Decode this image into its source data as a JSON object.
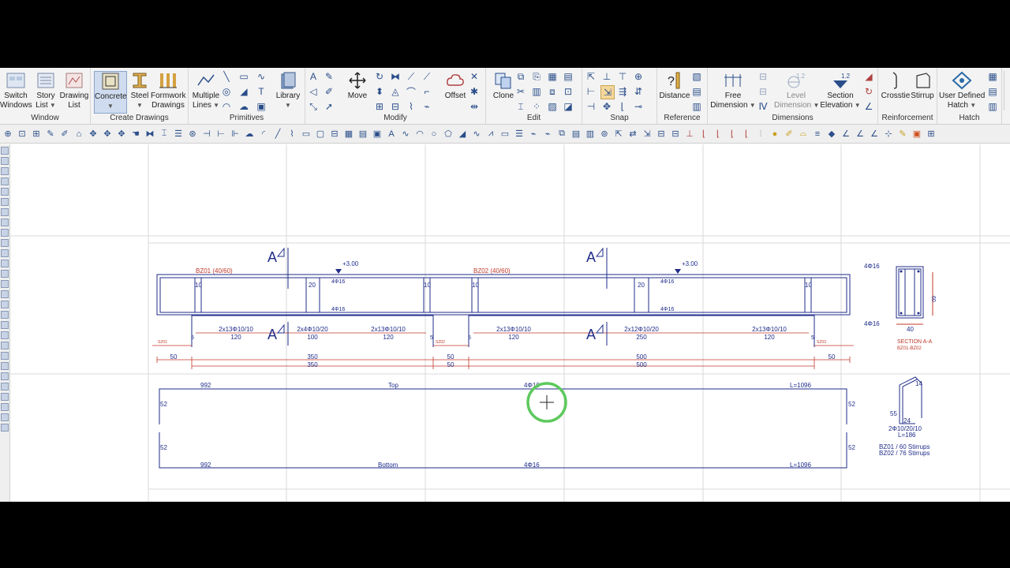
{
  "ribbon": {
    "window": {
      "title": "Window",
      "switch": "Switch",
      "switch2": "Windows",
      "story": "Story",
      "story2": "List",
      "drawing": "Drawing",
      "drawing2": "List"
    },
    "create": {
      "title": "Create Drawings",
      "concrete": "Concrete",
      "steel": "Steel",
      "formwork": "Formwork",
      "formwork2": "Drawings"
    },
    "primitives": {
      "title": "Primitives",
      "multiple": "Multiple",
      "multiple2": "Lines",
      "library": "Library"
    },
    "modify": {
      "title": "Modify",
      "move": "Move",
      "offset": "Offset"
    },
    "edit": {
      "title": "Edit",
      "clone": "Clone"
    },
    "snap": {
      "title": "Snap"
    },
    "reference": {
      "title": "Reference",
      "distance": "Distance"
    },
    "dimensions": {
      "title": "Dimensions",
      "free": "Free",
      "free2": "Dimension",
      "level": "Level",
      "level2": "Dimension",
      "level_val": "1.2",
      "section": "Section",
      "section2": "Elevation",
      "section_val": "1.2"
    },
    "reinforcement": {
      "title": "Reinforcement",
      "crosstie": "Crosstie",
      "stirrup": "Stirrup"
    },
    "hatch": {
      "title": "Hatch",
      "user": "User Defined",
      "user2": "Hatch"
    }
  },
  "drawing": {
    "beam1_label": "BZ01 (40/60)",
    "beam2_label": "BZ02 (40/60)",
    "level1": "+3.00",
    "level2": "+3.00",
    "section_mark": "A",
    "top_bar": "4Φ16",
    "bottom_bar": "4Φ16",
    "support_w": "10",
    "mid_w": "20",
    "stirrup_l1": "2x13Φ10/10",
    "stirrup_l2": "2x4Φ10/20",
    "stirrup_l3": "2x13Φ10/10",
    "stirrup_r1": "2x13Φ10/10",
    "stirrup_r2": "2x12Φ10/20",
    "stirrup_r3": "2x13Φ10/10",
    "len_120": "120",
    "len_100": "100",
    "len_250": "250",
    "s5": "5",
    "col1": "SZ01",
    "col2": "SZ02",
    "col3": "SZ03",
    "dim_50": "50",
    "dim_350": "350",
    "dim_500": "500",
    "bar_top_len": "992",
    "bar_top_label": "Top",
    "bar_top_total": "L=1096",
    "bar_bot_len": "992",
    "bar_bot_label": "Bottom",
    "bar_bot_total": "L=1096",
    "hook": "52",
    "section_top": "4Φ16",
    "section_bot": "4Φ16",
    "section_w": "40",
    "section_h": "60",
    "section_title": "SECTION A-A",
    "section_sub": "BZ01-BZ02",
    "stirrup_14": "14",
    "stirrup_55": "55",
    "stirrup_24": "24",
    "stirrup_spec": "2Φ10/20/10",
    "stirrup_len": "L=186",
    "stirrup_count1": "BZ01 / 60 Stirrups",
    "stirrup_count2": "BZ02 / 76 Stirrups"
  },
  "colors": {
    "ribbon_bg": "#f3f3f3",
    "line_blue": "#1f2d8a",
    "text_red": "#c0392b",
    "highlight": "#5ec95e"
  }
}
